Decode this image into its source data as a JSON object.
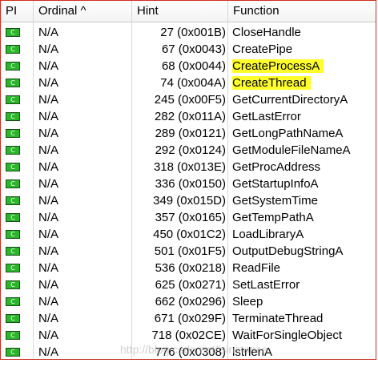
{
  "table": {
    "columns": [
      "PI",
      "Ordinal ^",
      "Hint",
      "Function"
    ],
    "rows": [
      {
        "pi": "C",
        "ordinal": "N/A",
        "hint": "27 (0x001B)",
        "function": "CloseHandle",
        "highlighted": false
      },
      {
        "pi": "C",
        "ordinal": "N/A",
        "hint": "67 (0x0043)",
        "function": "CreatePipe",
        "highlighted": false
      },
      {
        "pi": "C",
        "ordinal": "N/A",
        "hint": "68 (0x0044)",
        "function": "CreateProcessA",
        "highlighted": true
      },
      {
        "pi": "C",
        "ordinal": "N/A",
        "hint": "74 (0x004A)",
        "function": "CreateThread",
        "highlighted": true
      },
      {
        "pi": "C",
        "ordinal": "N/A",
        "hint": "245 (0x00F5)",
        "function": "GetCurrentDirectoryA",
        "highlighted": false
      },
      {
        "pi": "C",
        "ordinal": "N/A",
        "hint": "282 (0x011A)",
        "function": "GetLastError",
        "highlighted": false
      },
      {
        "pi": "C",
        "ordinal": "N/A",
        "hint": "289 (0x0121)",
        "function": "GetLongPathNameA",
        "highlighted": false
      },
      {
        "pi": "C",
        "ordinal": "N/A",
        "hint": "292 (0x0124)",
        "function": "GetModuleFileNameA",
        "highlighted": false
      },
      {
        "pi": "C",
        "ordinal": "N/A",
        "hint": "318 (0x013E)",
        "function": "GetProcAddress",
        "highlighted": false
      },
      {
        "pi": "C",
        "ordinal": "N/A",
        "hint": "336 (0x0150)",
        "function": "GetStartupInfoA",
        "highlighted": false
      },
      {
        "pi": "C",
        "ordinal": "N/A",
        "hint": "349 (0x015D)",
        "function": "GetSystemTime",
        "highlighted": false
      },
      {
        "pi": "C",
        "ordinal": "N/A",
        "hint": "357 (0x0165)",
        "function": "GetTempPathA",
        "highlighted": false
      },
      {
        "pi": "C",
        "ordinal": "N/A",
        "hint": "450 (0x01C2)",
        "function": "LoadLibraryA",
        "highlighted": false
      },
      {
        "pi": "C",
        "ordinal": "N/A",
        "hint": "501 (0x01F5)",
        "function": "OutputDebugStringA",
        "highlighted": false
      },
      {
        "pi": "C",
        "ordinal": "N/A",
        "hint": "536 (0x0218)",
        "function": "ReadFile",
        "highlighted": false
      },
      {
        "pi": "C",
        "ordinal": "N/A",
        "hint": "625 (0x0271)",
        "function": "SetLastError",
        "highlighted": false
      },
      {
        "pi": "C",
        "ordinal": "N/A",
        "hint": "662 (0x0296)",
        "function": "Sleep",
        "highlighted": false
      },
      {
        "pi": "C",
        "ordinal": "N/A",
        "hint": "671 (0x029F)",
        "function": "TerminateThread",
        "highlighted": false
      },
      {
        "pi": "C",
        "ordinal": "N/A",
        "hint": "718 (0x02CE)",
        "function": "WaitForSingleObject",
        "highlighted": false
      },
      {
        "pi": "C",
        "ordinal": "N/A",
        "hint": "776 (0x0308)",
        "function": "lstrlenA",
        "highlighted": false
      }
    ]
  },
  "pi_icon": "c-function-icon",
  "colors": {
    "highlight": "#ffff2b",
    "icon_fill": "#2bb52b",
    "frame_border": "#d12b1f"
  },
  "watermark": "http://blog.csdn.net/isinstance"
}
